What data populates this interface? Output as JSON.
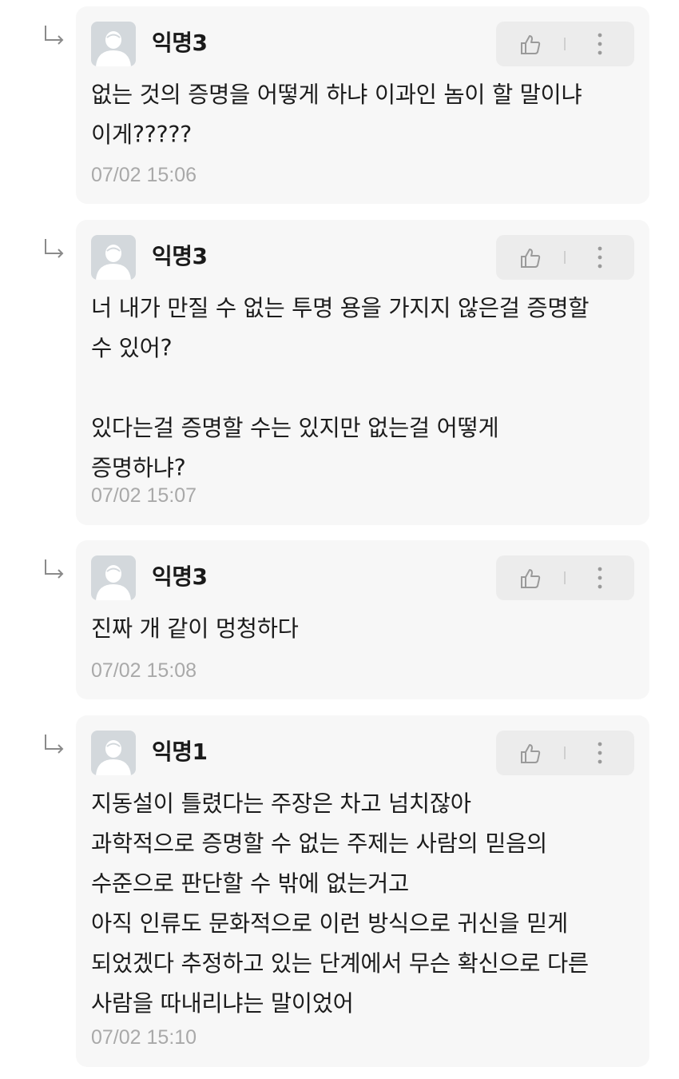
{
  "comments": [
    {
      "author": "익명3",
      "text": "없는 것의 증명을 어떻게 하냐 이과인 놈이 할 말이냐\n이게?????",
      "time": "07/02 15:06"
    },
    {
      "author": "익명3",
      "text": "너 내가 만질 수 없는 투명 용을 가지지 않은걸 증명할\n수 있어?\n\n있다는걸 증명할 수는 있지만 없는걸 어떻게\n증명하냐?",
      "time": "07/02 15:07"
    },
    {
      "author": "익명3",
      "text": "진짜 개 같이 멍청하다",
      "time": "07/02 15:08"
    },
    {
      "author": "익명1",
      "text": "지동설이 틀렸다는 주장은 차고 넘치잖아\n과학적으로 증명할 수 없는 주제는 사람의 믿음의\n수준으로 판단할 수 밖에 없는거고\n아직 인류도 문화적으로 이런 방식으로 귀신을 믿게\n되었겠다 추정하고 있는 단계에서 무슨 확신으로 다른\n사람을 따내리냐는 말이었어",
      "time": "07/02 15:10"
    }
  ],
  "icons": {
    "reply": "reply-arrow-icon",
    "avatar": "default-avatar-icon",
    "like": "thumbs-up-icon",
    "more": "more-vertical-icon"
  },
  "colors": {
    "card_bg": "#f7f7f7",
    "action_bg": "#ececec",
    "timestamp": "#a9a9a9",
    "avatar_bg": "#d3d8dc"
  }
}
